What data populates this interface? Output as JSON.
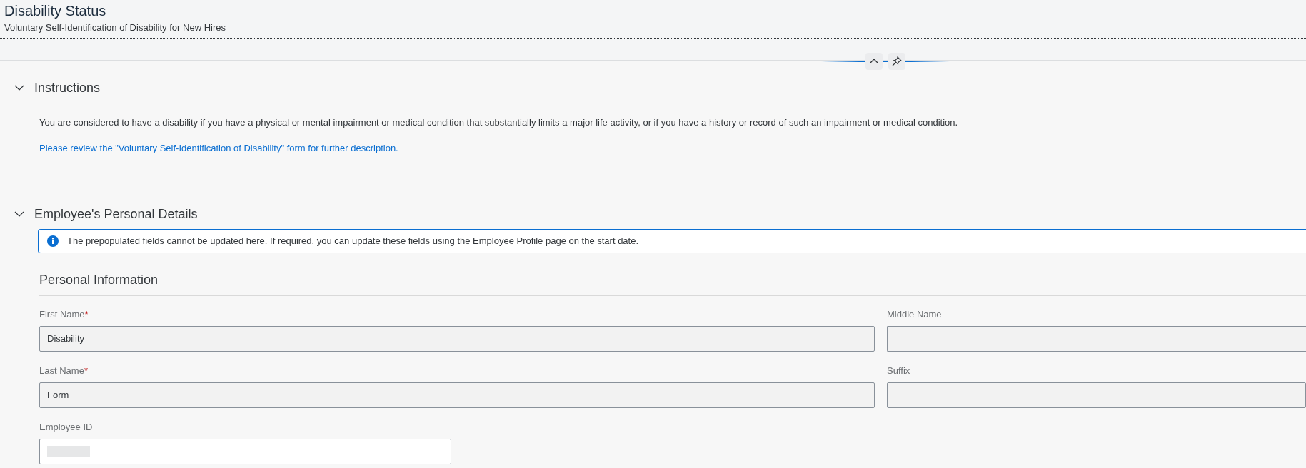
{
  "header": {
    "title": "Disability Status",
    "subtitle": "Voluntary Self-Identification of Disability for New Hires"
  },
  "sections": [
    {
      "title": "Instructions",
      "expanded": true,
      "paragraph": "You are considered to have a disability if you have a physical or mental impairment or medical condition that substantially limits a major life activity, or if you have a history or record of such an impairment or medical condition.",
      "link": "Please review the \"Voluntary Self-Identification of Disability\" form for further description."
    },
    {
      "title": "Employee's Personal Details",
      "expanded": true,
      "info": "The prepopulated fields cannot be updated here. If required, you can update these fields using the Employee Profile page on the start date.",
      "subsection": "Personal Information",
      "fields": [
        {
          "label": "First Name",
          "required_mark": "*",
          "value": "Disability",
          "disabled": true
        },
        {
          "label": "Middle Name",
          "disabled": true
        },
        {
          "label": "Last Name",
          "required_mark": "*",
          "value": "Form",
          "disabled": true
        },
        {
          "label": "Suffix",
          "disabled": true
        },
        {
          "label": "Employee ID",
          "disabled": false,
          "redacted": true
        }
      ]
    }
  ]
}
